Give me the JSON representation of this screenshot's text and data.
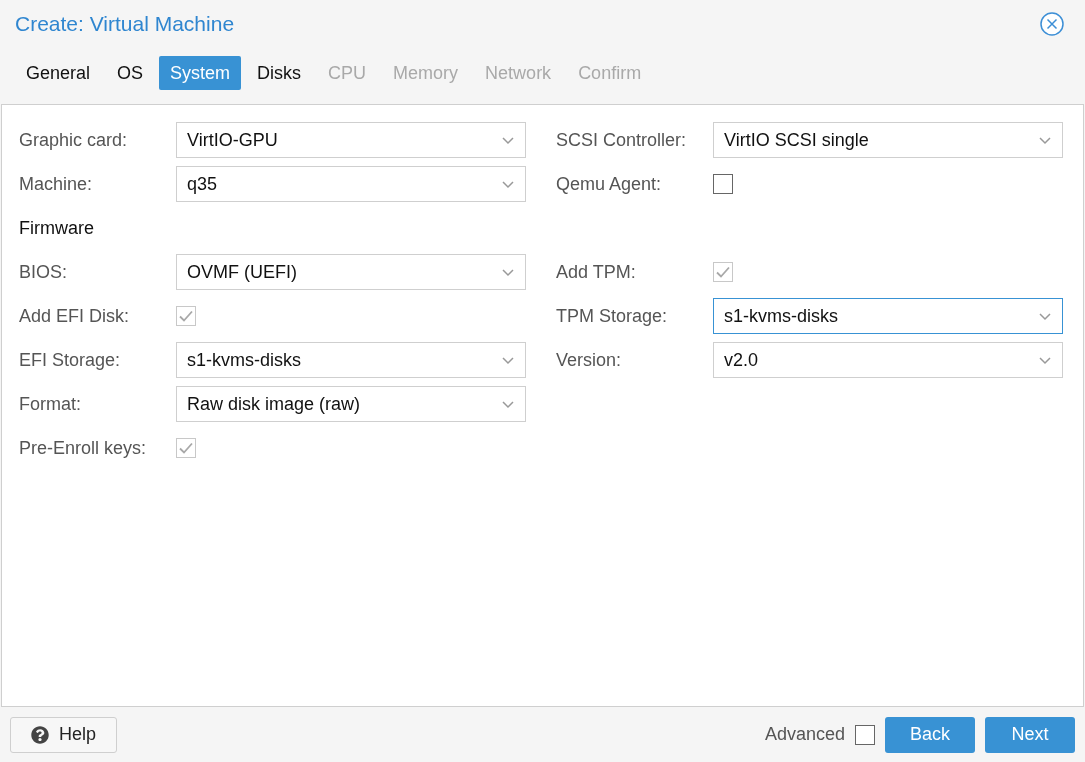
{
  "window": {
    "title": "Create: Virtual Machine"
  },
  "tabs": [
    {
      "label": "General",
      "selected": false,
      "disabled": false
    },
    {
      "label": "OS",
      "selected": false,
      "disabled": false
    },
    {
      "label": "System",
      "selected": true,
      "disabled": false
    },
    {
      "label": "Disks",
      "selected": false,
      "disabled": false
    },
    {
      "label": "CPU",
      "selected": false,
      "disabled": true
    },
    {
      "label": "Memory",
      "selected": false,
      "disabled": true
    },
    {
      "label": "Network",
      "selected": false,
      "disabled": true
    },
    {
      "label": "Confirm",
      "selected": false,
      "disabled": true
    }
  ],
  "rows": [
    {
      "left": {
        "kind": "select",
        "label": "Graphic card:",
        "value": "VirtIO-GPU",
        "focused": false
      },
      "right": {
        "kind": "select",
        "label": "SCSI Controller:",
        "value": "VirtIO SCSI single",
        "focused": false
      }
    },
    {
      "left": {
        "kind": "select",
        "label": "Machine:",
        "value": "q35",
        "focused": false
      },
      "right": {
        "kind": "checkbox",
        "label": "Qemu Agent:",
        "checked": false,
        "disabled": false
      }
    },
    {
      "left": {
        "kind": "heading",
        "label": "Firmware"
      }
    },
    {
      "left": {
        "kind": "select",
        "label": "BIOS:",
        "value": "OVMF (UEFI)",
        "focused": false
      },
      "right": {
        "kind": "checkbox",
        "label": "Add TPM:",
        "checked": true,
        "disabled": true
      }
    },
    {
      "left": {
        "kind": "checkbox",
        "label": "Add EFI Disk:",
        "checked": true,
        "disabled": true
      },
      "right": {
        "kind": "select",
        "label": "TPM Storage:",
        "value": "s1-kvms-disks",
        "focused": true
      }
    },
    {
      "left": {
        "kind": "select",
        "label": "EFI Storage:",
        "value": "s1-kvms-disks",
        "focused": false
      },
      "right": {
        "kind": "select",
        "label": "Version:",
        "value": "v2.0",
        "focused": false
      }
    },
    {
      "left": {
        "kind": "select",
        "label": "Format:",
        "value": "Raw disk image (raw)",
        "focused": false
      }
    },
    {
      "left": {
        "kind": "checkbox",
        "label": "Pre-Enroll keys:",
        "checked": true,
        "disabled": true
      }
    }
  ],
  "footer": {
    "help": "Help",
    "advanced": {
      "label": "Advanced",
      "checked": false
    },
    "back": "Back",
    "next": "Next"
  }
}
